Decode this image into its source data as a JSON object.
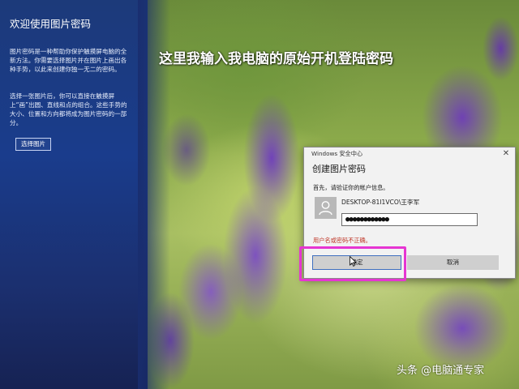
{
  "settings_panel": {
    "title": "欢迎使用图片密码",
    "description_1": "图片密码是一种帮助你保护触摸屏电脑的全新方法。你需要选择图片并在图片上画出各种手势，以此来创建你独一无二的密码。",
    "description_2": "选择一张图片后，你可以直接在触摸屏上“画”出圆、直线和点的组合。这些手势的大小、位置和方向都将成为图片密码的一部分。",
    "choose_picture_label": "选择图片"
  },
  "caption": "这里我输入我电脑的原始开机登陆密码",
  "dialog": {
    "app_name": "Windows 安全中心",
    "close_glyph": "✕",
    "heading": "创建图片密码",
    "instruction": "首先，请验证你的帐户信息。",
    "account": "DESKTOP-81I1VCO\\王李军",
    "password_value": "●●●●●●●●●●●●",
    "error": "用户名或密码不正确。",
    "ok_label": "确定",
    "cancel_label": "取消"
  },
  "watermark": "头条 @电脑通专家",
  "colors": {
    "highlight": "#e636d2",
    "error": "#c0392b",
    "panel_blue": "#1a3c8c",
    "focus_border": "#3f6fbf"
  },
  "icons": {
    "avatar": "user-icon",
    "close": "close-icon",
    "cursor": "mouse-pointer-icon"
  }
}
